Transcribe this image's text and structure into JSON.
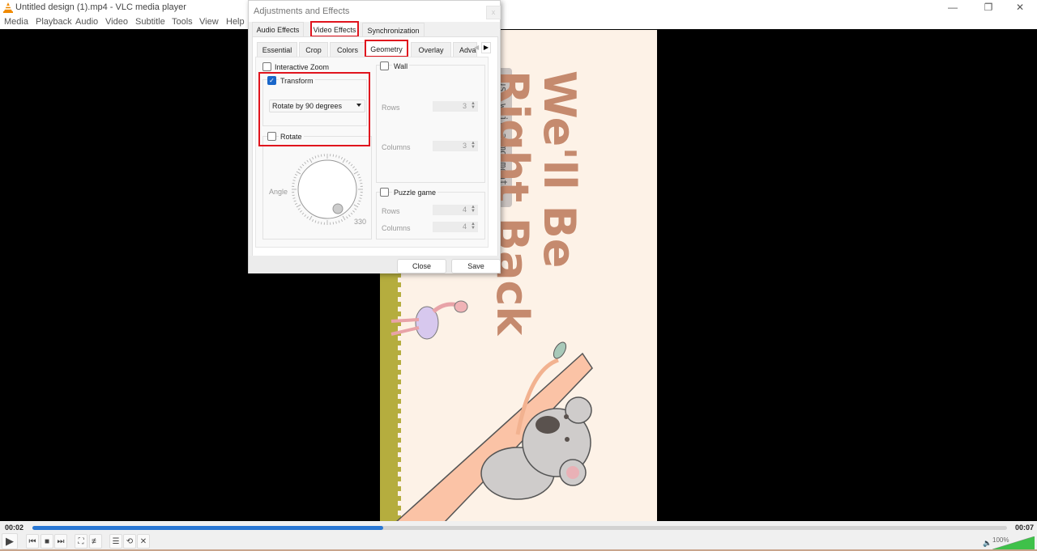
{
  "window": {
    "title": "Untitled design (1).mp4 - VLC media player",
    "controls": {
      "minimize": "—",
      "restore": "❐",
      "close": "✕"
    }
  },
  "menubar": [
    "Media",
    "Playback",
    "Audio",
    "Video",
    "Subtitle",
    "Tools",
    "View",
    "Help"
  ],
  "video": {
    "headline_line1": "We'll Be",
    "headline_line2": "Right Back",
    "subtitle": "Just wait a momment"
  },
  "dialog": {
    "title": "Adjustments and Effects",
    "close_icon": "x",
    "main_tabs": [
      {
        "label": "Audio Effects",
        "active": false
      },
      {
        "label": "Video Effects",
        "active": true
      },
      {
        "label": "Synchronization",
        "active": false
      }
    ],
    "sub_tabs": [
      {
        "label": "Essential",
        "active": false
      },
      {
        "label": "Crop",
        "active": false
      },
      {
        "label": "Colors",
        "active": false
      },
      {
        "label": "Geometry",
        "active": true
      },
      {
        "label": "Overlay",
        "active": false
      },
      {
        "label": "Adva",
        "active": false
      }
    ],
    "geometry": {
      "interactive_zoom": {
        "label": "Interactive Zoom",
        "checked": false
      },
      "transform": {
        "label": "Transform",
        "checked": true,
        "selected": "Rotate by 90 degrees"
      },
      "rotate": {
        "label": "Rotate",
        "checked": false,
        "angle_label": "Angle",
        "angle_value": "330"
      },
      "wall": {
        "label": "Wall",
        "checked": false,
        "rows_label": "Rows",
        "rows": "3",
        "columns_label": "Columns",
        "columns": "3"
      },
      "puzzle": {
        "label": "Puzzle game",
        "checked": false,
        "rows_label": "Rows",
        "rows": "4",
        "columns_label": "Columns",
        "columns": "4"
      }
    },
    "buttons": {
      "close": "Close",
      "save": "Save"
    }
  },
  "player": {
    "elapsed": "00:02",
    "total": "00:07",
    "progress_percent": 36,
    "volume": "100%",
    "volume_percent": 100,
    "accent": "#2a78d4"
  }
}
